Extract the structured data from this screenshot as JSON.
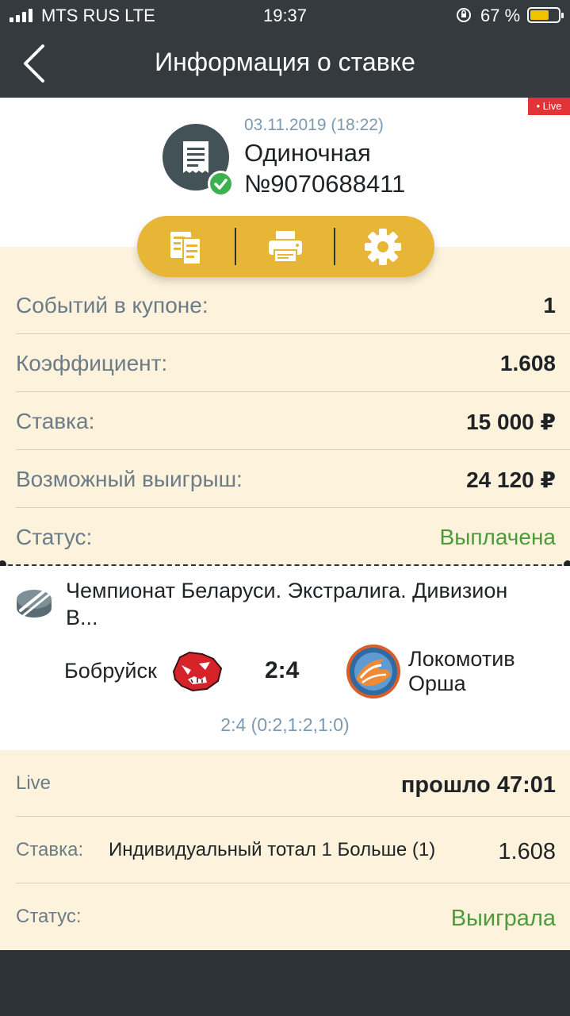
{
  "status_bar": {
    "carrier": "MTS RUS LTE",
    "time": "19:37",
    "battery_percent": "67 %",
    "battery_level": 0.67
  },
  "header": {
    "title": "Информация о ставке",
    "back_icon": "chevron-left-icon"
  },
  "receipt": {
    "live_badge": "• Live",
    "date": "03.11.2019 (18:22)",
    "type": "Одиночная",
    "number": "№9070688411",
    "icon": "receipt-icon",
    "status_icon": "check-circle-icon"
  },
  "actions": [
    {
      "name": "copy-coupon",
      "icon": "document-copy-icon"
    },
    {
      "name": "print",
      "icon": "printer-icon"
    },
    {
      "name": "settings",
      "icon": "gear-icon"
    }
  ],
  "summary": {
    "events_label": "Событий в купоне:",
    "events_value": "1",
    "coef_label": "Коэффициент:",
    "coef_value": "1.608",
    "stake_label": "Ставка:",
    "stake_value": "15 000 ₽",
    "win_label": "Возможный выигрыш:",
    "win_value": "24 120 ₽",
    "status_label": "Статус:",
    "status_value": "Выплачена"
  },
  "event": {
    "sport_icon": "hockey-puck-icon",
    "league": "Чемпионат Беларуси. Экстралига. Дивизион B...",
    "team1": "Бобруйск",
    "team1_logo": "bobruisk-logo",
    "score": "2:4",
    "team2": "Локомотив Орша",
    "team2_logo": "lokomotiv-orsha-logo",
    "periods": "2:4 (0:2,1:2,1:0)"
  },
  "detail": {
    "live_label": "Live",
    "elapsed": "прошло 47:01",
    "bet_label": "Ставка:",
    "bet_desc": "Индивидуальный тотал 1 Больше (1)",
    "bet_coef": "1.608",
    "status_label": "Статус:",
    "status_value": "Выиграла"
  },
  "colors": {
    "header_bg": "#353a3e",
    "accent": "#e7b637",
    "section_bg": "#fdf3dc",
    "success": "#4c9a3b",
    "live": "#e23437"
  }
}
